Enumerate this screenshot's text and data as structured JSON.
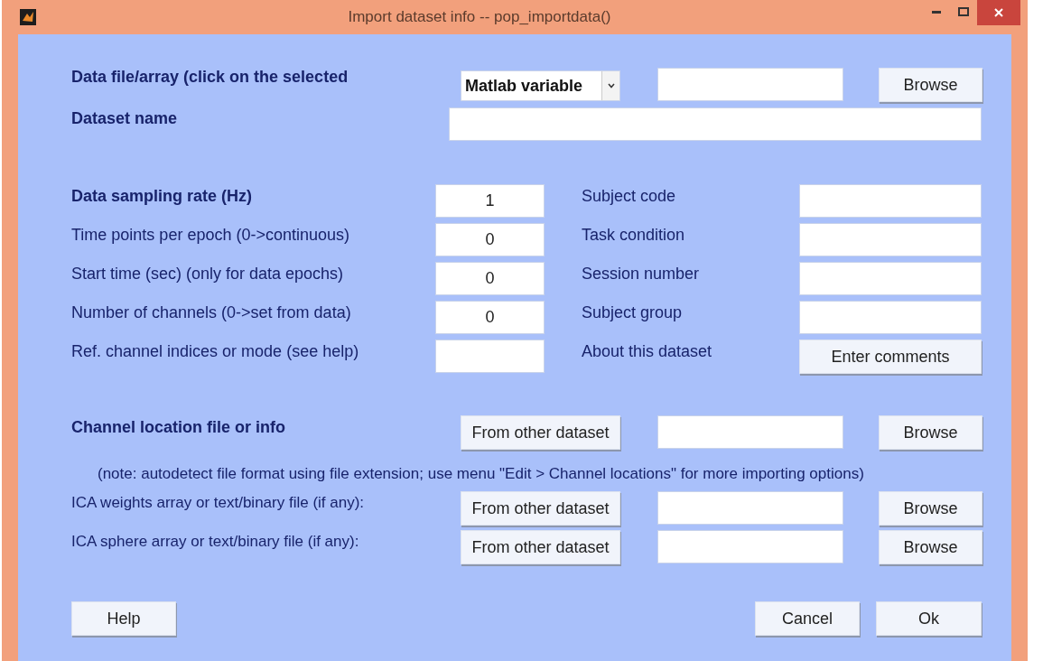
{
  "window": {
    "title": "Import dataset info -- pop_importdata()"
  },
  "data_file": {
    "label": "Data file/array (click on the selected",
    "selector": "Matlab variable",
    "button": "Browse"
  },
  "dataset_name": {
    "label": "Dataset name"
  },
  "parameters": [
    {
      "label": "Data sampling rate (Hz)",
      "value": "1",
      "bold": true
    },
    {
      "label": "Time points per epoch (0->continuous)",
      "value": "0",
      "bold": false
    },
    {
      "label": "Start time (sec) (only for data epochs)",
      "value": "0",
      "bold": false
    },
    {
      "label": "Number of channels (0->set from data)",
      "value": "0",
      "bold": false
    },
    {
      "label": "Ref. channel indices or mode (see help)",
      "bold": false
    }
  ],
  "info": [
    {
      "label": "Subject code",
      "kind": "field"
    },
    {
      "label": "Task condition",
      "kind": "field"
    },
    {
      "label": "Session number",
      "kind": "field"
    },
    {
      "label": "Subject group",
      "kind": "field"
    },
    {
      "label": "About this dataset",
      "kind": "button",
      "button": "Enter comments"
    }
  ],
  "channel_location": {
    "label": "Channel location file or info",
    "source_button": "From other dataset",
    "browse_button": "Browse",
    "note": "(note: autodetect file format using file extension; use menu \"Edit > Channel locations\" for more importing options)"
  },
  "ica": [
    {
      "label": "ICA weights array or text/binary file (if any):",
      "source_button": "From other dataset",
      "browse_button": "Browse"
    },
    {
      "label": "ICA sphere array or text/binary file (if any):",
      "source_button": "From other dataset",
      "browse_button": "Browse"
    }
  ],
  "footer": {
    "help": "Help",
    "cancel": "Cancel",
    "ok": "Ok"
  }
}
